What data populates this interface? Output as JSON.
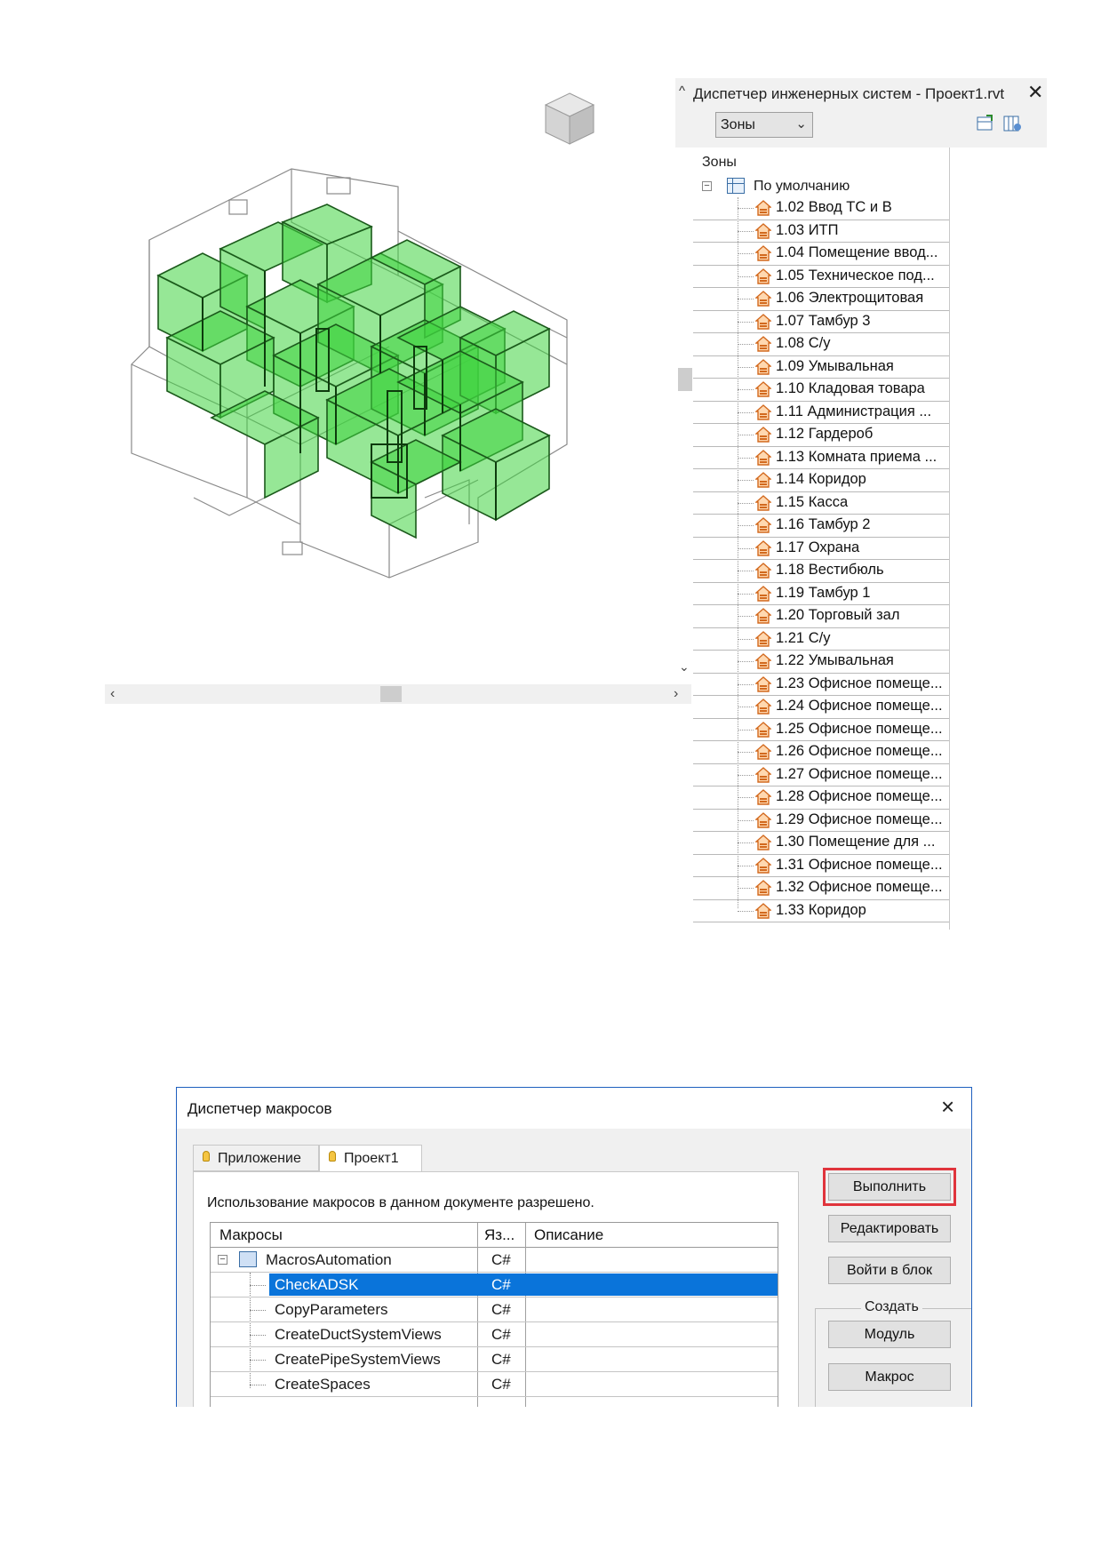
{
  "systems_browser": {
    "title": "Диспетчер инженерных систем - Проект1.rvt",
    "view_select": "Зоны",
    "root_label": "Зоны",
    "default_label": "По умолчанию",
    "zones": [
      "1.02 Ввод ТС и В",
      "1.03 ИТП",
      "1.04 Помещение ввод...",
      "1.05 Техническое под...",
      "1.06 Электрощитовая",
      "1.07 Тамбур 3",
      "1.08 С/у",
      "1.09 Умывальная",
      "1.10 Кладовая товара",
      "1.11 Администрация ...",
      "1.12 Гардероб",
      "1.13 Комната приема ...",
      "1.14 Коридор",
      "1.15 Касса",
      "1.16 Тамбур 2",
      "1.17 Охрана",
      "1.18 Вестибюль",
      "1.19 Тамбур 1",
      "1.20 Торговый зал",
      "1.21 С/у",
      "1.22 Умывальная",
      "1.23 Офисное помеще...",
      "1.24 Офисное помеще...",
      "1.25 Офисное помеще...",
      "1.26 Офисное помеще...",
      "1.27 Офисное помеще...",
      "1.28 Офисное помеще...",
      "1.29 Офисное помеще...",
      "1.30 Помещение для ...",
      "1.31 Офисное помеще...",
      "1.32 Офисное помеще...",
      "1.33 Коридор"
    ]
  },
  "macro_manager": {
    "title": "Диспетчер макросов",
    "tabs": [
      "Приложение",
      "Проект1"
    ],
    "active_tab": "Проект1",
    "status": "Использование макросов в данном документе разрешено.",
    "columns": [
      "Макросы",
      "Яз...",
      "Описание"
    ],
    "module": {
      "name": "MacrosAutomation",
      "lang": "C#"
    },
    "macros": [
      {
        "name": "CheckADSK",
        "lang": "C#"
      },
      {
        "name": "CopyParameters",
        "lang": "C#"
      },
      {
        "name": "CreateDuctSystemViews",
        "lang": "C#"
      },
      {
        "name": "CreatePipeSystemViews",
        "lang": "C#"
      },
      {
        "name": "CreateSpaces",
        "lang": "C#"
      }
    ],
    "selected_macro": "CheckADSK",
    "buttons": {
      "run": "Выполнить",
      "edit": "Редактировать",
      "step_into": "Войти в блок",
      "create_group": "Создать",
      "module": "Модуль",
      "macro": "Макрос"
    }
  },
  "icons": [
    "viewcube-icon",
    "house-zone-icon",
    "grid-icon",
    "bulb-icon",
    "module-icon",
    "close-icon"
  ],
  "colors": {
    "zone_fill": "#3fd43f",
    "selection": "#0a74da",
    "highlight_frame": "#e0343c"
  }
}
